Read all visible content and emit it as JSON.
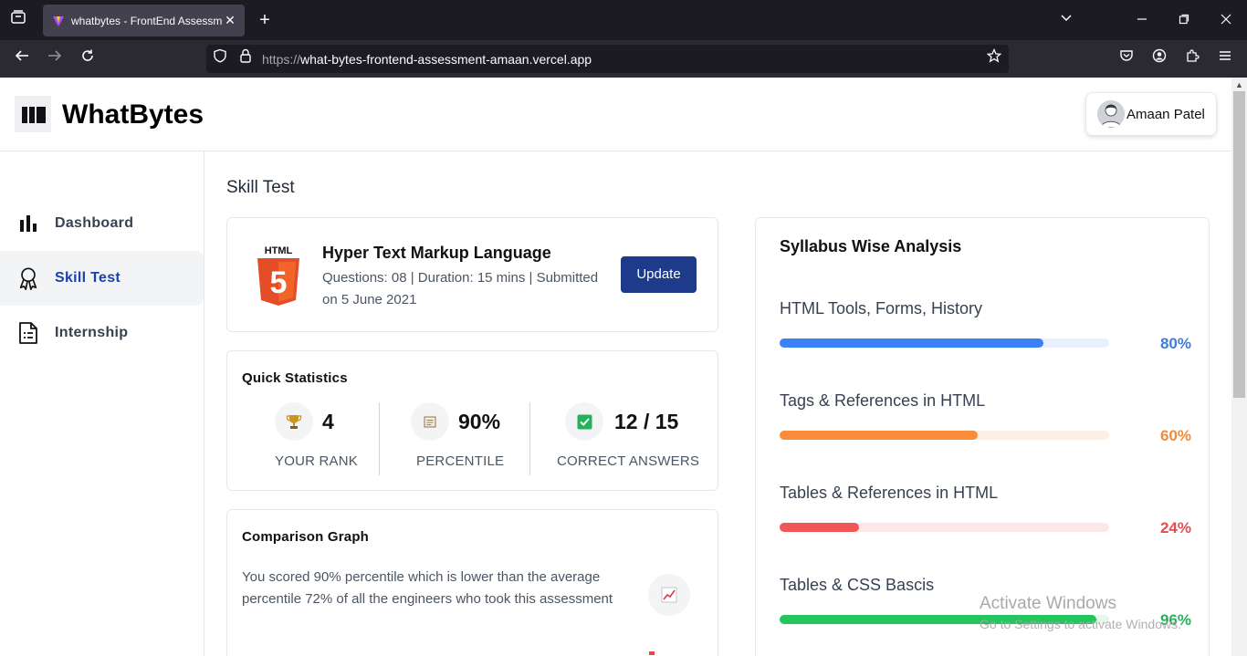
{
  "browser": {
    "tab_title": "whatbytes - FrontEnd Assessme",
    "url_scheme": "https://",
    "url_host": "what-bytes-frontend-assessment-amaan.vercel.app"
  },
  "header": {
    "logo_text": "WhatBytes",
    "user_name": "Amaan Patel"
  },
  "sidebar": {
    "items": [
      {
        "label": "Dashboard",
        "icon": "bar-chart-icon",
        "active": false
      },
      {
        "label": "Skill Test",
        "icon": "award-icon",
        "active": true
      },
      {
        "label": "Internship",
        "icon": "document-icon",
        "active": false
      }
    ]
  },
  "main": {
    "title": "Skill Test",
    "test_card": {
      "title": "Hyper Text Markup Language",
      "description": "Questions: 08 | Duration: 15 mins | Submitted on 5 June 2021",
      "button_label": "Update",
      "logo_text": "HTML",
      "logo_digit": "5"
    },
    "quick_stats": {
      "title": "Quick Statistics",
      "items": [
        {
          "value": "4",
          "label": "YOUR RANK",
          "icon": "trophy-icon"
        },
        {
          "value": "90%",
          "label": "PERCENTILE",
          "icon": "clipboard-icon"
        },
        {
          "value": "12 / 15",
          "label": "CORRECT ANSWERS",
          "icon": "check-icon"
        }
      ]
    },
    "comparison": {
      "title": "Comparison Graph",
      "text": "You scored 90% percentile which is lower than the average percentile 72% of all the engineers who took this assessment",
      "icon": "trend-chart-icon"
    },
    "syllabus": {
      "title": "Syllabus Wise Analysis",
      "items": [
        {
          "label": "HTML Tools, Forms, History",
          "percent_text": "80%",
          "value": 0.8,
          "color": "#3b82f6",
          "track": "#e8f0fe",
          "text_color": "#3b7ddd"
        },
        {
          "label": "Tags & References in HTML",
          "percent_text": "60%",
          "value": 0.6,
          "color": "#fb8c3c",
          "track": "#fdeee4",
          "text_color": "#f28a3c"
        },
        {
          "label": "Tables & References in HTML",
          "percent_text": "24%",
          "value": 0.24,
          "color": "#f25757",
          "track": "#fde8e8",
          "text_color": "#e84c4c"
        },
        {
          "label": "Tables & CSS Bascis",
          "percent_text": "96%",
          "value": 0.96,
          "color": "#22c55e",
          "track": "#e6f7ed",
          "text_color": "#22b35a"
        }
      ]
    }
  },
  "os_watermark": {
    "line1": "Activate Windows",
    "line2": "Go to Settings to activate Windows."
  }
}
